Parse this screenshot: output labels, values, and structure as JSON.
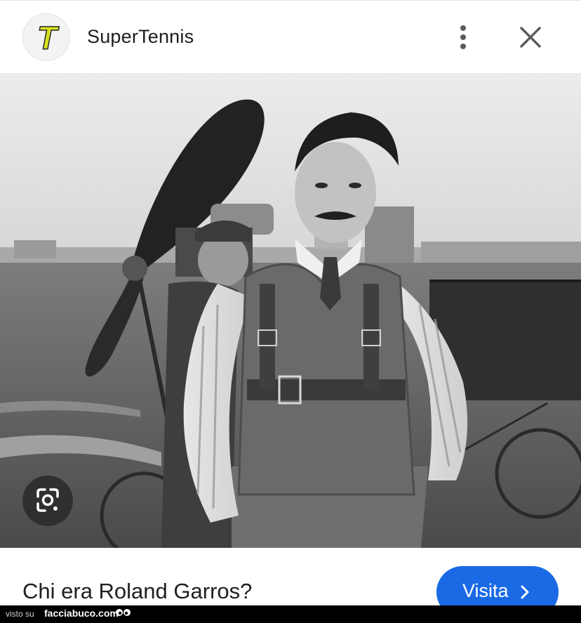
{
  "header": {
    "logo_letter": "T",
    "site_name": "SuperTennis",
    "more_icon": "vertical-dots-icon",
    "close_icon": "close-icon"
  },
  "image": {
    "content": "black-and-white photo",
    "lens_icon": "google-lens-icon"
  },
  "caption": {
    "title": "Chi era Roland Garros?",
    "visit_label": "Visita",
    "visit_icon": "chevron-right-icon"
  },
  "watermark": {
    "prefix": "visto su",
    "site": "facciabuco.com",
    "icon": "eyes-icon"
  },
  "colors": {
    "accent_button": "#1a6ae6",
    "logo_letter": "#d8e020",
    "text_primary": "#1f1f1f"
  }
}
